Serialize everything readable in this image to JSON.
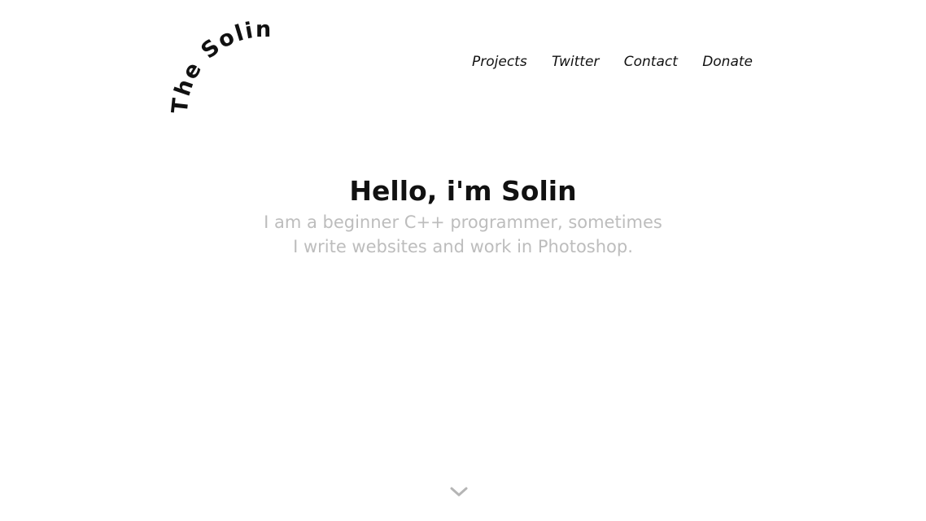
{
  "logo": {
    "text": "The Solin."
  },
  "nav": {
    "items": [
      {
        "label": "Projects"
      },
      {
        "label": "Twitter"
      },
      {
        "label": "Contact"
      },
      {
        "label": "Donate"
      }
    ]
  },
  "hero": {
    "title": "Hello, i'm Solin",
    "subtitle_line1": "I am a beginner C++ programmer, sometimes",
    "subtitle_line2": "I write websites and work in Photoshop."
  },
  "scroll": {
    "icon": "chevron-down-icon",
    "color": "#b5b5b5"
  },
  "colors": {
    "text": "#111111",
    "muted": "#bdbdbd",
    "background": "#ffffff"
  }
}
